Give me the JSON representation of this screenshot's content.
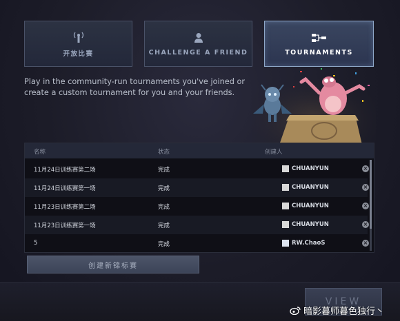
{
  "tabs": [
    {
      "label": "开放比赛",
      "icon": "broadcast-icon",
      "active": false
    },
    {
      "label": "CHALLENGE A FRIEND",
      "icon": "person-icon",
      "active": false
    },
    {
      "label": "TOURNAMENTS",
      "icon": "bracket-icon",
      "active": true
    }
  ],
  "description": "Play in the community-run tournaments you've joined or create a custom tournament for you and your friends.",
  "table": {
    "headers": [
      "名称",
      "状态",
      "创建人"
    ],
    "rows": [
      {
        "name": "11月24日训练赛第二场",
        "status": "完成",
        "creator": "CHUANYUN"
      },
      {
        "name": "11月24日训练赛第一场",
        "status": "完成",
        "creator": "CHUANYUN"
      },
      {
        "name": "11月23日训练赛第二场",
        "status": "完成",
        "creator": "CHUANYUN"
      },
      {
        "name": "11月23日训练赛第一场",
        "status": "完成",
        "creator": "CHUANYUN"
      },
      {
        "name": "5",
        "status": "完成",
        "creator": "RW.ChaoS"
      }
    ]
  },
  "create_button": "创建新锦标赛",
  "view_button": "VIEW",
  "watermark": "暗影暮师暮色独行丶",
  "colors": {
    "accent": "#8fa8c8",
    "background": "#1c1c28"
  }
}
